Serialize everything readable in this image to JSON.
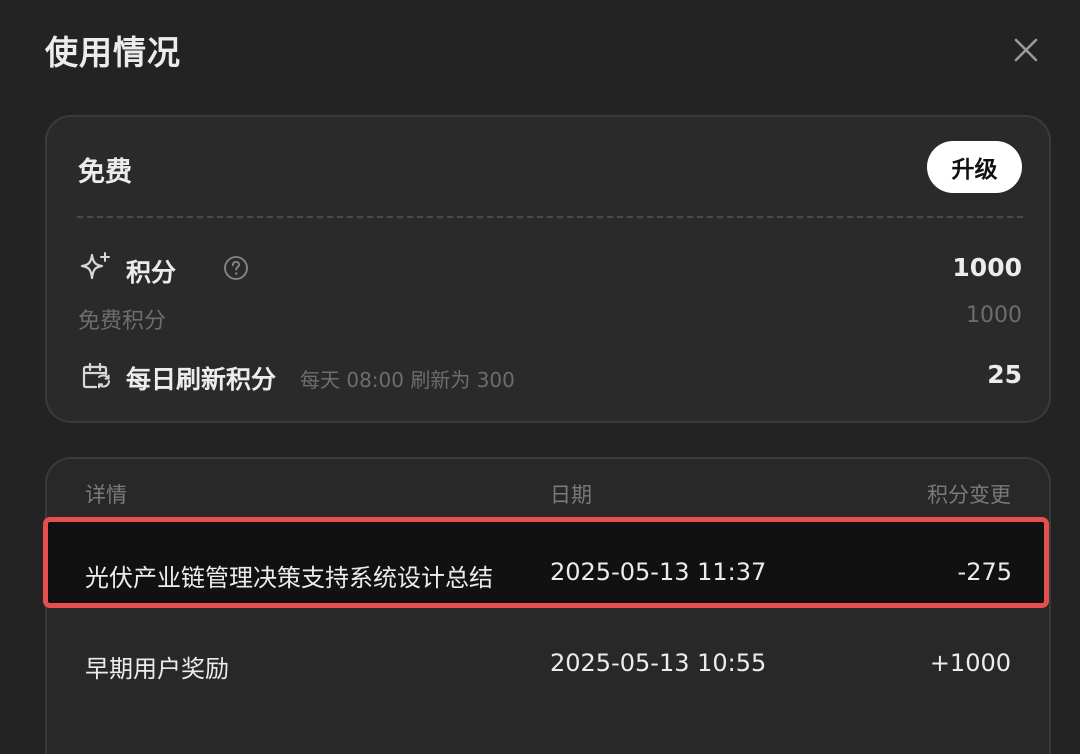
{
  "dialog": {
    "title": "使用情况"
  },
  "plan": {
    "name": "免费",
    "upgrade_label": "升级",
    "credits_label": "积分",
    "credits_value": "1000",
    "free_credits_label": "免费积分",
    "free_credits_value": "1000",
    "daily_label": "每日刷新积分",
    "daily_note": "每天 08:00 刷新为 300",
    "daily_value": "25"
  },
  "history": {
    "columns": [
      "详情",
      "日期",
      "积分变更"
    ],
    "rows": [
      {
        "detail": "光伏产业链管理决策支持系统设计总结",
        "date": "2025-05-13 11:37",
        "change": "-275"
      },
      {
        "detail": "早期用户奖励",
        "date": "2025-05-13 10:55",
        "change": "+1000"
      }
    ]
  },
  "colors": {
    "background": "#232323",
    "card": "#2a2a2a",
    "highlight_border": "#e5504f",
    "muted_text": "#6d6d6d"
  },
  "icons": [
    "close-icon",
    "sparkle-icon",
    "help-icon",
    "calendar-refresh-icon"
  ]
}
